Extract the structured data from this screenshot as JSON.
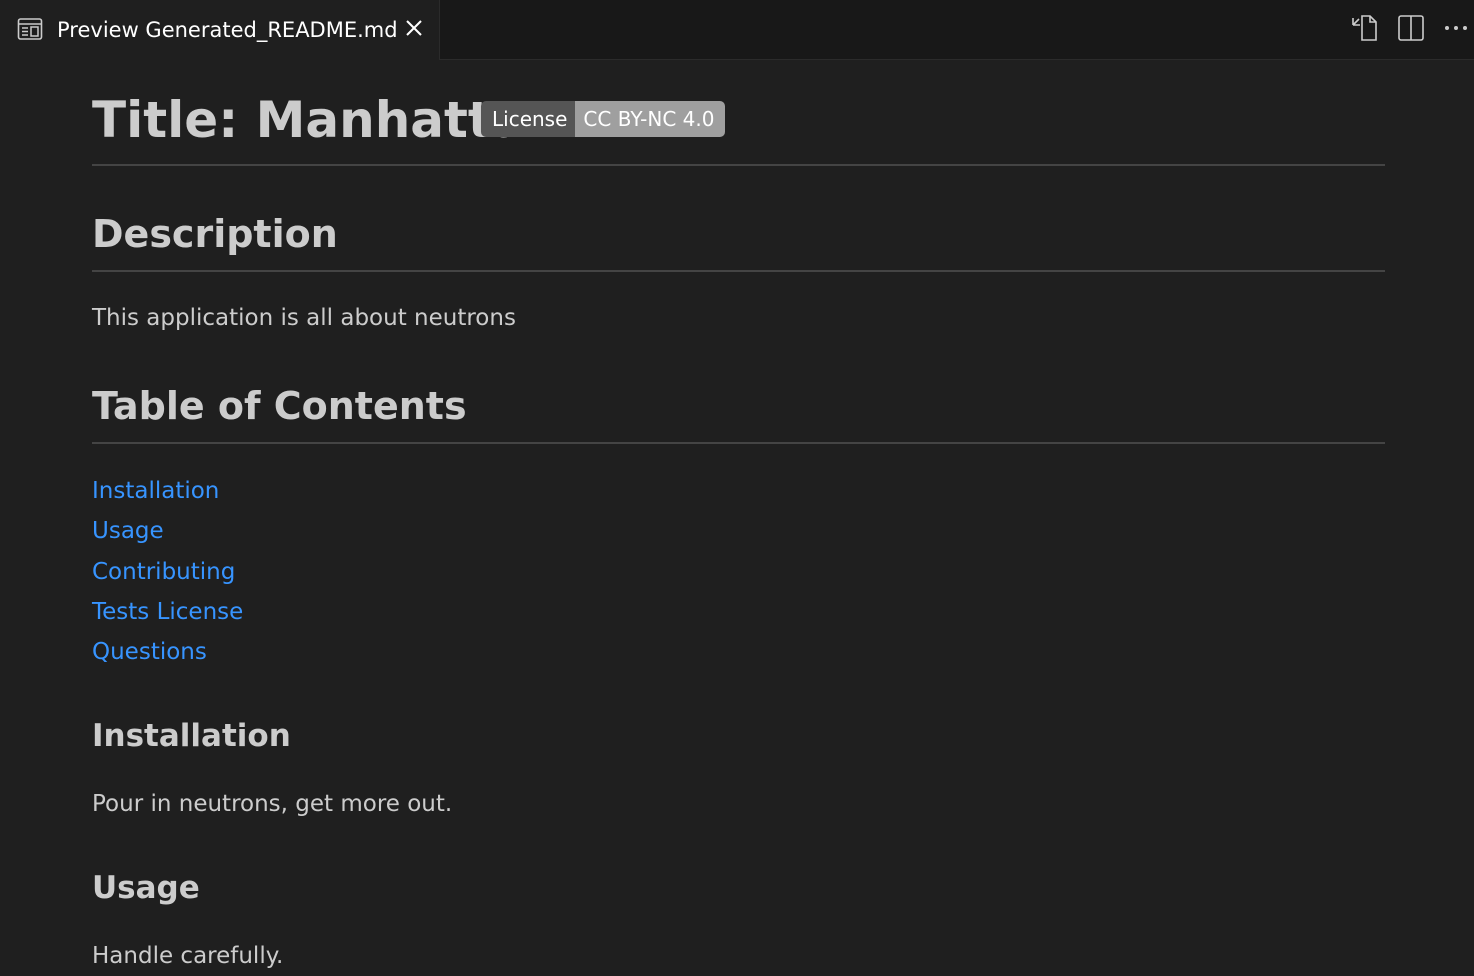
{
  "tab": {
    "label": "Preview Generated_README.md",
    "icon": "preview-icon",
    "close_icon": "close-icon"
  },
  "toolbar": {
    "icons": [
      "open-source-icon",
      "split-editor-icon",
      "more-actions-icon"
    ]
  },
  "document": {
    "title": "Title: Manhattan",
    "badge": {
      "label": "License",
      "value": "CC BY-NC 4.0"
    },
    "description": {
      "heading": "Description",
      "text": "This application is all about neutrons"
    },
    "toc": {
      "heading": "Table of Contents",
      "links": [
        "Installation",
        "Usage",
        "Contributing",
        "Tests License",
        "Questions"
      ]
    },
    "installation": {
      "heading": "Installation",
      "text": "Pour in neutrons, get more out."
    },
    "usage": {
      "heading": "Usage",
      "text": "Handle carefully."
    }
  },
  "colors": {
    "background": "#1f1f1f",
    "tabbar": "#181818",
    "text": "#cccccc",
    "link": "#3794ff",
    "badge_left": "#555555",
    "badge_right": "#9f9f9f"
  }
}
